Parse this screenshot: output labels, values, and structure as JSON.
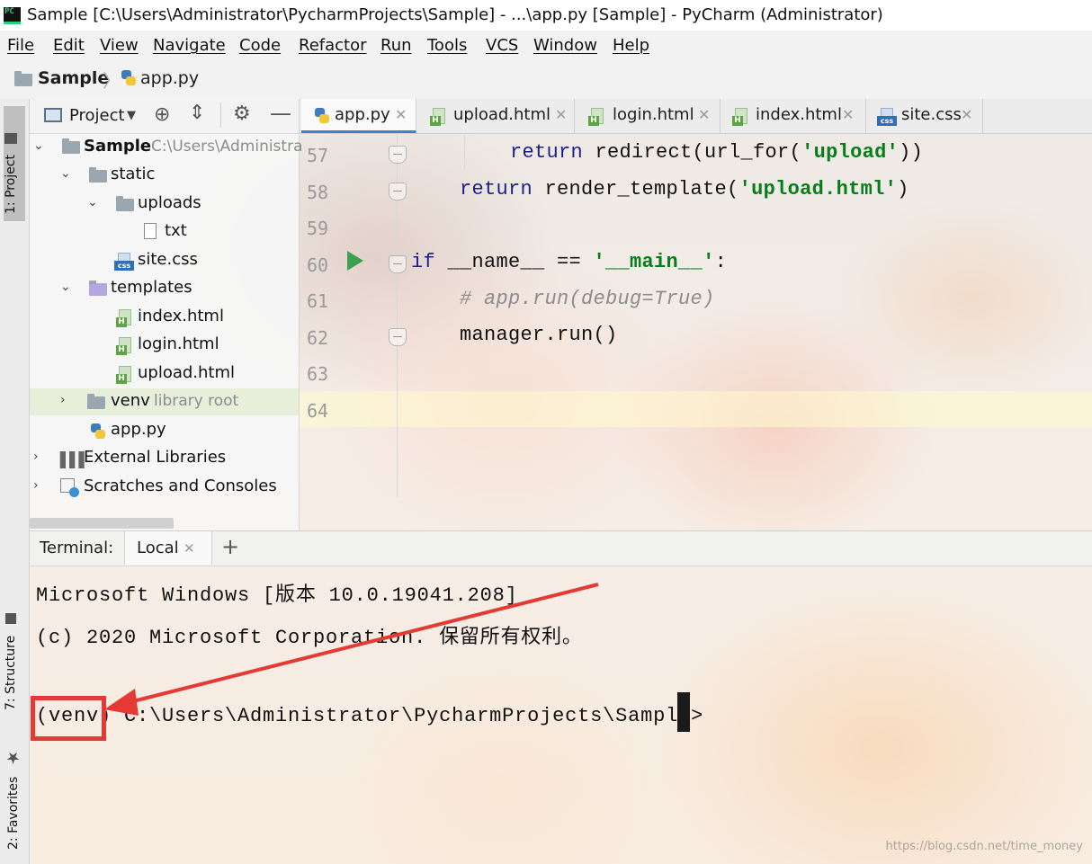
{
  "window": {
    "title": "Sample [C:\\Users\\Administrator\\PycharmProjects\\Sample] - ...\\app.py [Sample] - PyCharm (Administrator)"
  },
  "menu": [
    "File",
    "Edit",
    "View",
    "Navigate",
    "Code",
    "Refactor",
    "Run",
    "Tools",
    "VCS",
    "Window",
    "Help"
  ],
  "breadcrumb": {
    "project": "Sample",
    "file": "app.py"
  },
  "toolstrip": {
    "project": "1: Project",
    "structure": "7: Structure",
    "favorites": "2: Favorites"
  },
  "project_panel": {
    "selector": "Project",
    "tree": [
      {
        "label": "Sample",
        "hint": "C:\\Users\\Administra"
      },
      {
        "label": "static"
      },
      {
        "label": "uploads"
      },
      {
        "label": "txt"
      },
      {
        "label": "site.css"
      },
      {
        "label": "templates"
      },
      {
        "label": "index.html"
      },
      {
        "label": "login.html"
      },
      {
        "label": "upload.html"
      },
      {
        "label": "venv",
        "hint": "library root"
      },
      {
        "label": "app.py"
      },
      {
        "label": "External Libraries"
      },
      {
        "label": "Scratches and Consoles"
      }
    ]
  },
  "editor": {
    "tabs": [
      "app.py",
      "upload.html",
      "login.html",
      "index.html",
      "site.css"
    ],
    "line_numbers": [
      "57",
      "58",
      "59",
      "60",
      "61",
      "62",
      "63",
      "64"
    ],
    "code": {
      "l57": {
        "kw": "return",
        "a": " redirect(url_for(",
        "s": "'upload'",
        "b": "))"
      },
      "l58": {
        "kw": "return",
        "a": " render_template(",
        "s": "'upload.html'",
        "b": ")"
      },
      "l60": {
        "kw": "if",
        "a": " __name__ == ",
        "s": "'__main__'",
        "b": ":"
      },
      "l61": "# app.run(debug=True)",
      "l62": "manager.run()"
    }
  },
  "terminal": {
    "label": "Terminal:",
    "tab": "Local",
    "add": "+",
    "lines": [
      "Microsoft Windows [版本 10.0.19041.208]",
      "(c) 2020 Microsoft Corporation. 保留所有权利。",
      "(venv) C:\\Users\\Administrator\\PycharmProjects\\Sample>"
    ]
  },
  "watermark": "https://blog.csdn.net/time_money",
  "colors": {
    "annotation": "#e53935",
    "keyword": "#1c1e8a",
    "string": "#067d17"
  }
}
